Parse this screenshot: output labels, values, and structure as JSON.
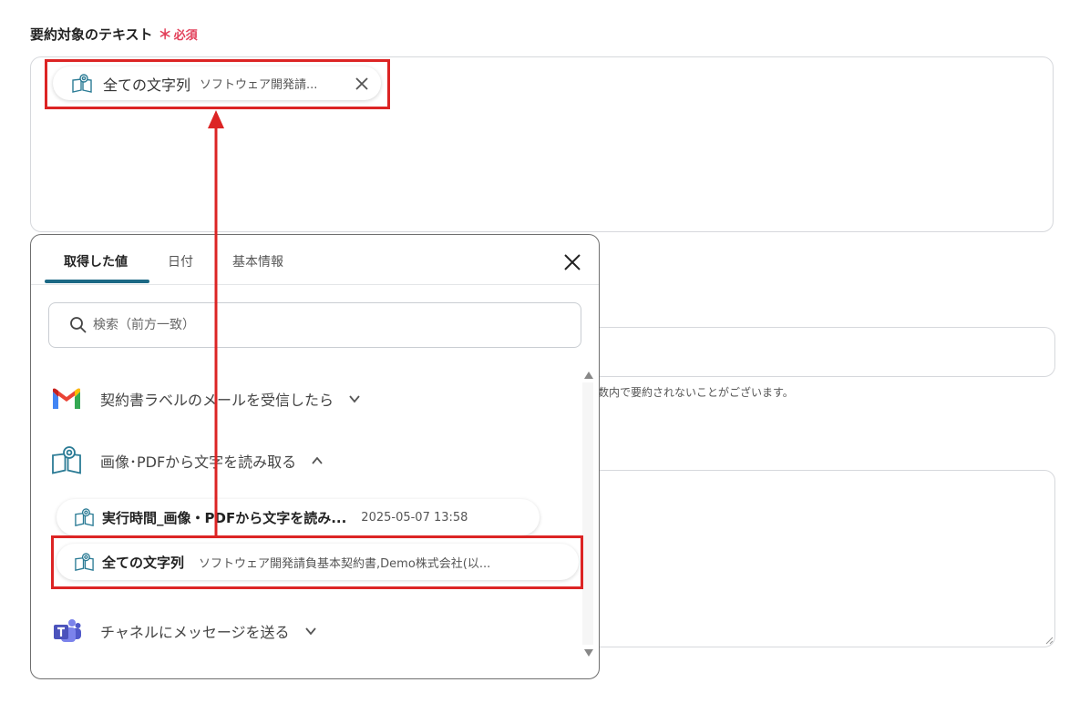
{
  "field": {
    "label": "要約対象のテキスト",
    "required_mark": "＊",
    "required_label": "必須"
  },
  "selected_chip": {
    "label": "全ての文字列",
    "value": "ソフトウェア開発請...",
    "close_icon": "close-icon"
  },
  "background": {
    "help_text": "数内で要約されないことがございます。"
  },
  "popover": {
    "tabs": [
      {
        "label": "取得した値",
        "active": true
      },
      {
        "label": "日付",
        "active": false
      },
      {
        "label": "基本情報",
        "active": false
      }
    ],
    "search_placeholder": "検索（前方一致）",
    "groups": [
      {
        "label": "契約書ラベルのメールを受信したら",
        "icon": "gmail-icon",
        "expanded": false
      },
      {
        "label": "画像･PDFから文字を読み取る",
        "icon": "ocr-book-icon",
        "expanded": true
      },
      {
        "label": "チャネルにメッセージを送る",
        "icon": "teams-icon",
        "expanded": false
      }
    ],
    "items": [
      {
        "label": "実行時間_画像・PDFから文字を読み...",
        "value": "2025-05-07 13:58"
      },
      {
        "label": "全ての文字列",
        "value": "ソフトウェア開発請負基本契約書,Demo株式会社(以..."
      }
    ]
  },
  "colors": {
    "annotation_red": "#dc2424",
    "tab_accent": "#1c6985",
    "required": "#e2405a"
  }
}
